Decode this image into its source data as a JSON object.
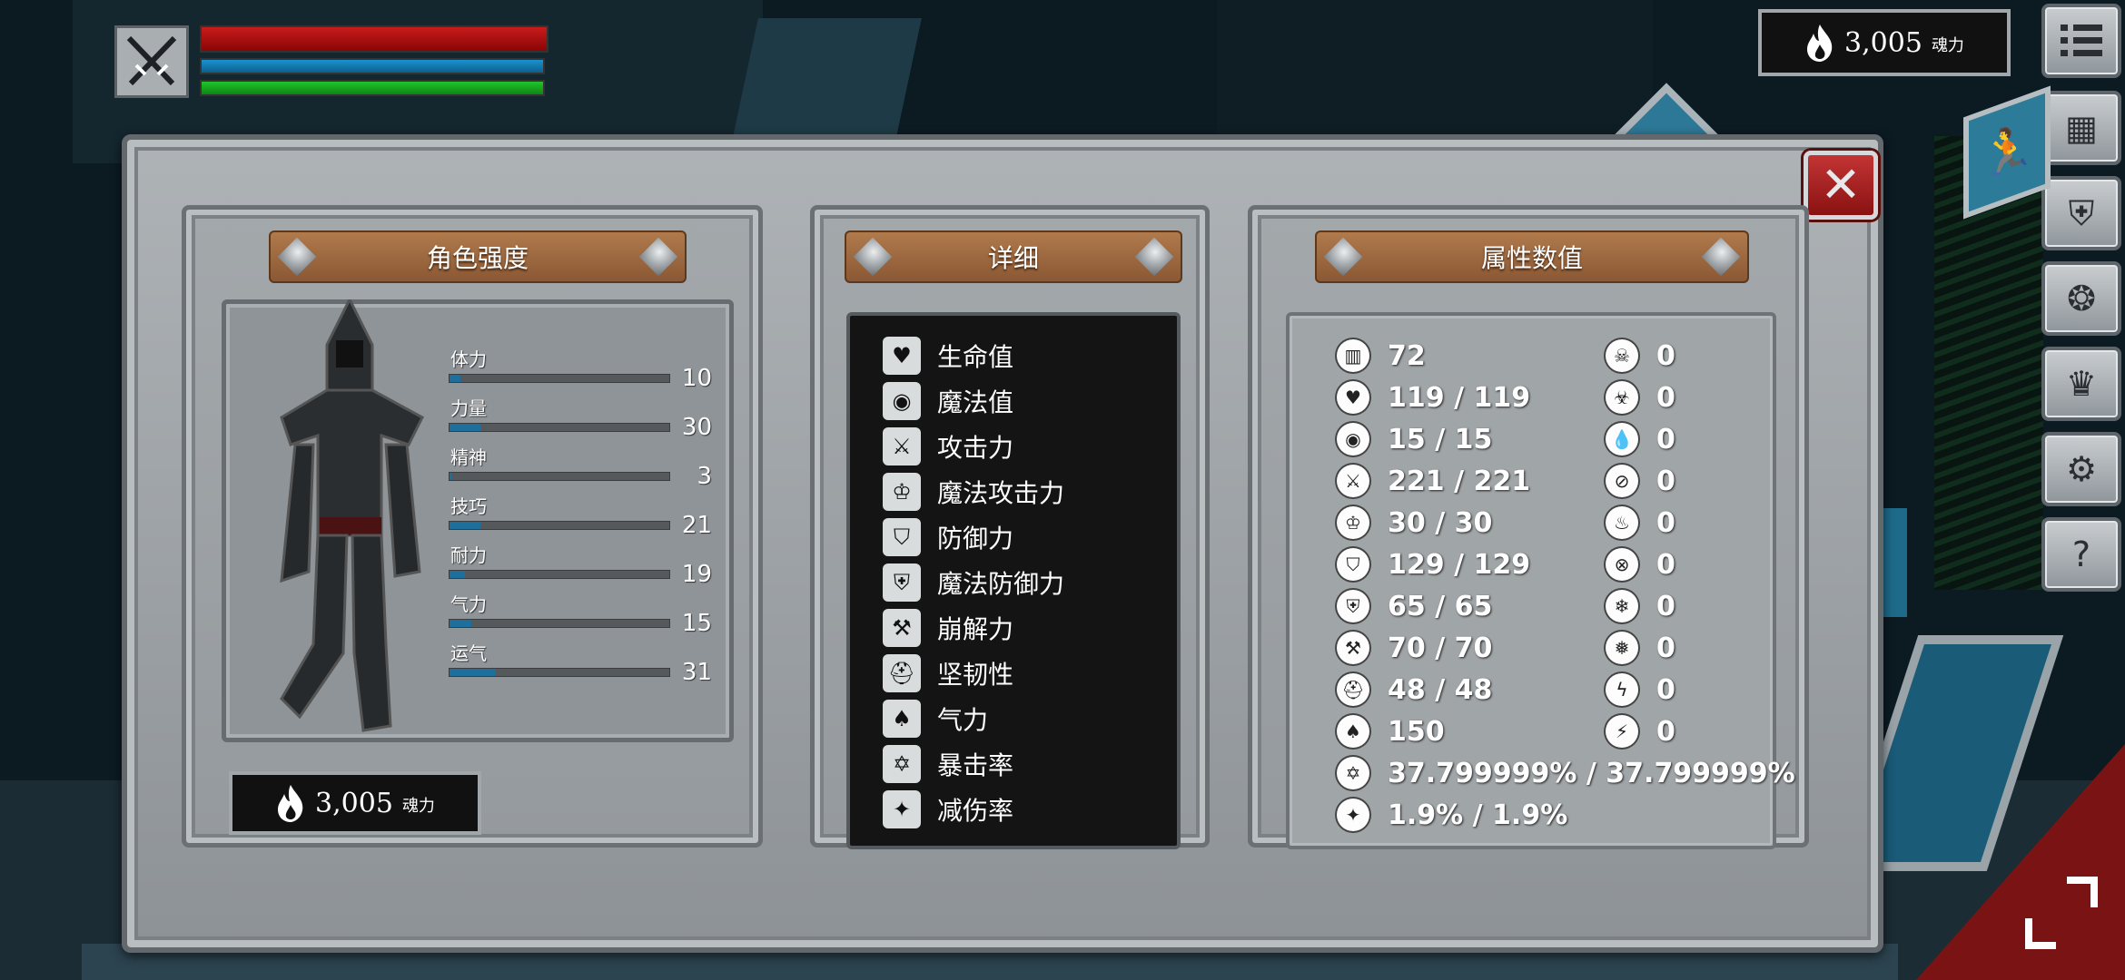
{
  "hud": {
    "hp_fraction": 1.0,
    "mp_fraction": 1.0,
    "stamina_fraction": 1.0
  },
  "currency": {
    "amount": "3,005",
    "unit": "魂力"
  },
  "side_menu": {
    "icons": [
      "menu-icon",
      "character-icon",
      "equipment-icon",
      "skills-icon",
      "crown-icon",
      "settings-icon",
      "help-icon"
    ]
  },
  "panels": {
    "character": {
      "title": "角色强度",
      "stats": [
        {
          "label": "体力",
          "value": "10",
          "fraction": 0.05
        },
        {
          "label": "力量",
          "value": "30",
          "fraction": 0.14
        },
        {
          "label": "精神",
          "value": "3",
          "fraction": 0.01
        },
        {
          "label": "技巧",
          "value": "21",
          "fraction": 0.14
        },
        {
          "label": "耐力",
          "value": "19",
          "fraction": 0.07
        },
        {
          "label": "气力",
          "value": "15",
          "fraction": 0.1
        },
        {
          "label": "运气",
          "value": "31",
          "fraction": 0.21
        }
      ]
    },
    "detail": {
      "title": "详细",
      "items": [
        "生命值",
        "魔法值",
        "攻击力",
        "魔法攻击力",
        "防御力",
        "魔法防御力",
        "崩解力",
        "坚韧性",
        "气力",
        "暴击率",
        "减伤率"
      ]
    },
    "attributes": {
      "title": "属性数值",
      "left": [
        "72",
        "119 / 119",
        "15 / 15",
        "221 / 221",
        "30 / 30",
        "129 / 129",
        "65 / 65",
        "70 / 70",
        "48 / 48",
        "150",
        "37.799999% / 37.799999%",
        "1.9% / 1.9%"
      ],
      "right": [
        "0",
        "0",
        "0",
        "0",
        "0",
        "0",
        "0",
        "0",
        "0",
        "0"
      ]
    }
  },
  "colors": {
    "hp": "#c81c1c",
    "mp": "#1a92d0",
    "stamina": "#21c42a",
    "stat_bar": "#1f6f9c",
    "close_button": "#c33434",
    "plank": "#a06a40"
  }
}
